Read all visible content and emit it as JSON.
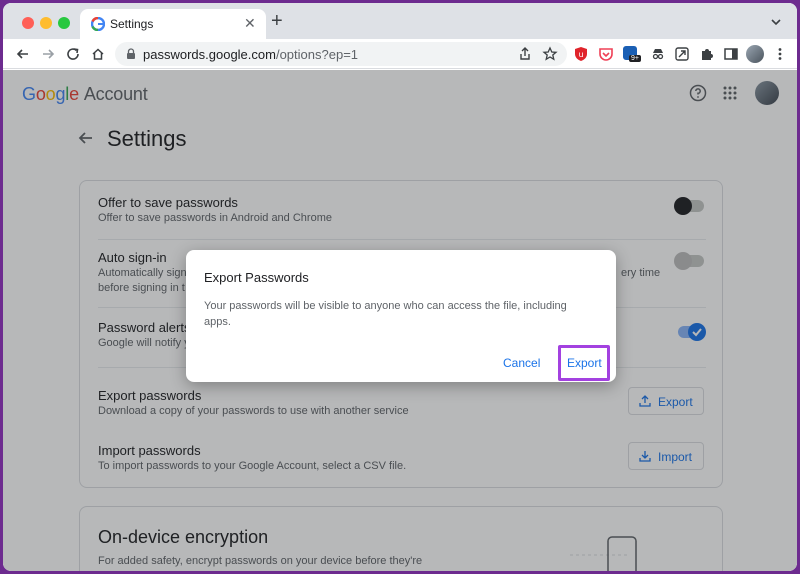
{
  "browser": {
    "tab_title": "Settings",
    "tab_close": "✕",
    "new_tab": "+",
    "url_host": "passwords.google.com",
    "url_path": "/options?ep=1",
    "extension_badge": "9+"
  },
  "header": {
    "logo_letters": [
      "G",
      "o",
      "o",
      "g",
      "l",
      "e"
    ],
    "logo_suffix": "Account"
  },
  "page": {
    "title": "Settings"
  },
  "settings": [
    {
      "title": "Offer to save passwords",
      "subtitle": "Offer to save passwords in Android and Chrome",
      "toggle_on": false
    },
    {
      "title": "Auto sign-in",
      "subtitle_left": "Automatically sign",
      "subtitle_left2": "before signing in t",
      "subtitle_right": "ery time",
      "toggle_on": false
    },
    {
      "title": "Password alerts",
      "subtitle": "Google will notify y",
      "toggle_on": true
    },
    {
      "title": "Export passwords",
      "subtitle": "Download a copy of your passwords to use with another service",
      "button": "Export"
    },
    {
      "title": "Import passwords",
      "subtitle": "To import passwords to your Google Account, select a CSV file.",
      "button": "Import"
    }
  ],
  "encryption": {
    "title": "On-device encryption",
    "subtitle": "For added safety, encrypt passwords on your device before they're"
  },
  "dialog": {
    "title": "Export Passwords",
    "body": "Your passwords will be visible to anyone who can access the file, including apps.",
    "cancel_label": "Cancel",
    "export_label": "Export"
  },
  "colors": {
    "accent": "#1a73e8",
    "highlight": "#a341e0",
    "frame": "#6d2b8f"
  }
}
